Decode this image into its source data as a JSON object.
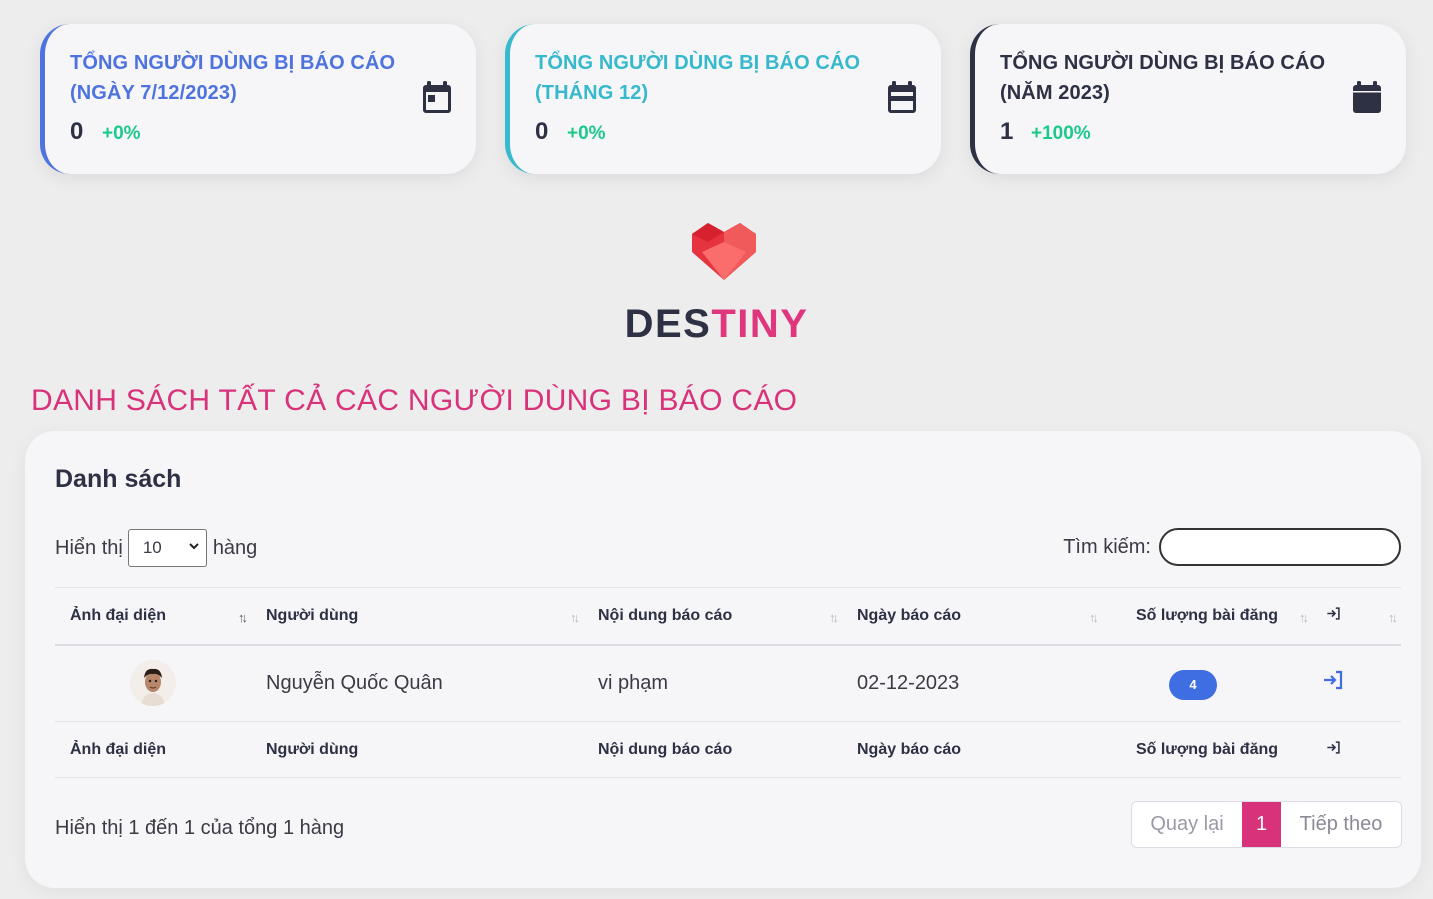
{
  "cards": [
    {
      "title": "TỔNG NGƯỜI DÙNG BỊ BÁO CÁO (NGÀY 7/12/2023)",
      "value": "0",
      "change": "+0%",
      "icon": "calendar-day-icon",
      "accent": "#4e73df"
    },
    {
      "title": "TỔNG NGƯỜI DÙNG BỊ BÁO CÁO (THÁNG 12)",
      "value": "0",
      "change": "+0%",
      "icon": "calendar-month-icon",
      "accent": "#36b9cc"
    },
    {
      "title": "TỔNG NGƯỜI DÙNG BỊ BÁO CÁO (NĂM 2023)",
      "value": "1",
      "change": "+100%",
      "icon": "calendar-year-icon",
      "accent": "#2e3044"
    }
  ],
  "brand": {
    "part1": "DES",
    "part2": "TINY",
    "logo_icon": "heart-logo-icon"
  },
  "page_heading": "DANH SÁCH TẤT CẢ CÁC NGƯỜI DÙNG BỊ BÁO CÁO",
  "panel": {
    "title": "Danh sách",
    "length": {
      "prefix": "Hiển thị",
      "selected": "10",
      "suffix": "hàng"
    },
    "search": {
      "label": "Tìm kiếm:",
      "value": ""
    },
    "columns": [
      "Ảnh đại diện",
      "Người dùng",
      "Nội dung báo cáo",
      "Ngày báo cáo",
      "Số lượng bài đăng"
    ],
    "action_icon": "sign-in-icon",
    "rows": [
      {
        "avatar": "avatar-icon",
        "user": "Nguyễn Quốc Quân",
        "content": "vi phạm",
        "date": "02-12-2023",
        "posts": "4",
        "action": "sign-in-icon"
      }
    ],
    "info": "Hiển thị 1 đến 1 của tổng 1 hàng",
    "pager": {
      "prev": "Quay lại",
      "current": "1",
      "next": "Tiếp theo"
    }
  },
  "colors": {
    "brand_pink": "#d8327a",
    "badge_blue": "#3f6ee2",
    "positive_green": "#1cc88a",
    "background": "#eeedee"
  }
}
